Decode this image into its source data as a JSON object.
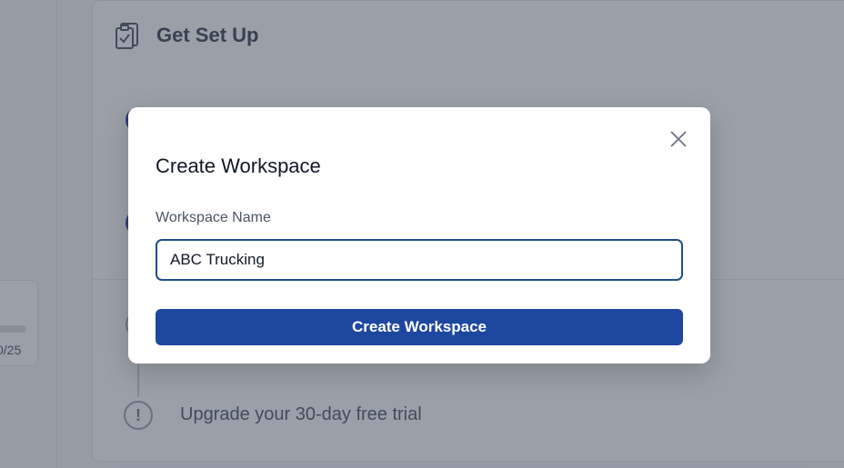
{
  "background": {
    "progress": {
      "text": "0/25",
      "fraction": 0.0
    },
    "setup": {
      "title": "Get Set Up",
      "icon": "clipboard-check-icon",
      "steps": [
        {
          "state": "done"
        },
        {
          "state": "done"
        },
        {
          "state": "pending"
        },
        {
          "state": "warning",
          "label": "Upgrade your 30-day free trial",
          "icon": "exclamation-icon"
        }
      ]
    }
  },
  "modal": {
    "title": "Create Workspace",
    "close_icon": "close-icon",
    "field": {
      "label": "Workspace Name",
      "value": "ABC Trucking",
      "placeholder": ""
    },
    "submit_label": "Create Workspace"
  },
  "colors": {
    "primary": "#1e47a0",
    "input_border": "#1d4f8f",
    "overlay": "rgba(55, 65, 81, 0.5)"
  }
}
